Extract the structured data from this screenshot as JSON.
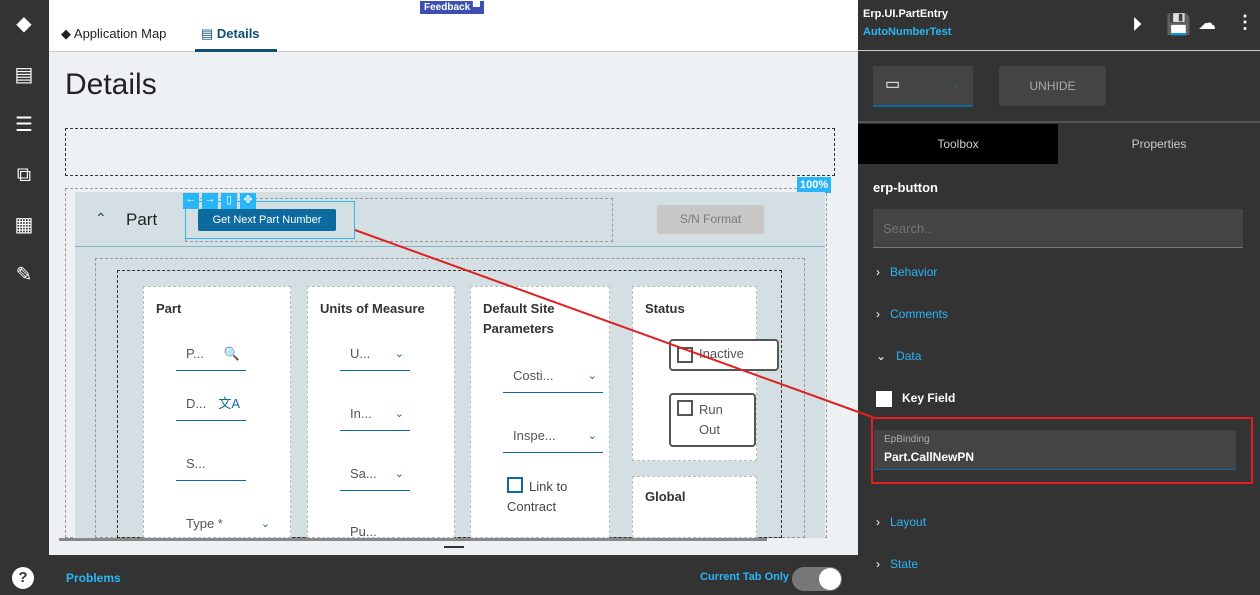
{
  "sidebar": {
    "items": [
      "layers-icon",
      "details-icon",
      "checklist-icon",
      "flow-icon",
      "grid-icon",
      "edit-doc-icon"
    ],
    "help": "?"
  },
  "tabs": [
    {
      "label": "Application Map"
    },
    {
      "label": "Details"
    }
  ],
  "feedback": "Feedback",
  "page_title": "Details",
  "zoom": "100%",
  "panel": {
    "title": "Part",
    "get_next_button": "Get Next Part Number",
    "sn_format_button": "S/N Format"
  },
  "columns": {
    "part": {
      "title": "Part",
      "fields": [
        "P...",
        "D...",
        "S...",
        "Type *"
      ]
    },
    "uom": {
      "title": "Units of Measure",
      "fields": [
        "U...",
        "In...",
        "Sa...",
        "Pu..."
      ]
    },
    "site": {
      "title": "Default Site Parameters",
      "fields": [
        "Costi...",
        "Inspe..."
      ],
      "checkbox": "Link to Contract"
    },
    "status": {
      "title": "Status",
      "checkboxes": [
        "Inactive",
        "Run Out"
      ],
      "global": "Global"
    }
  },
  "bottom": {
    "problems": "Problems",
    "current_tab_only": "Current Tab Only"
  },
  "right": {
    "app": "Erp.UI.PartEntry",
    "layer": "AutoNumberTest",
    "unhide": "UNHIDE",
    "tabs": [
      "Toolbox",
      "Properties"
    ],
    "component": "erp-button",
    "search_placeholder": "Search..",
    "sections": [
      "Behavior",
      "Comments",
      "Data",
      "Layout",
      "State"
    ],
    "key_field": "Key Field",
    "binding_label": "EpBinding",
    "binding_value": "Part.CallNewPN"
  },
  "colors": {
    "accent": "#29b6f6",
    "primary_button": "#0d6a9e",
    "annotation": "#e02020"
  }
}
